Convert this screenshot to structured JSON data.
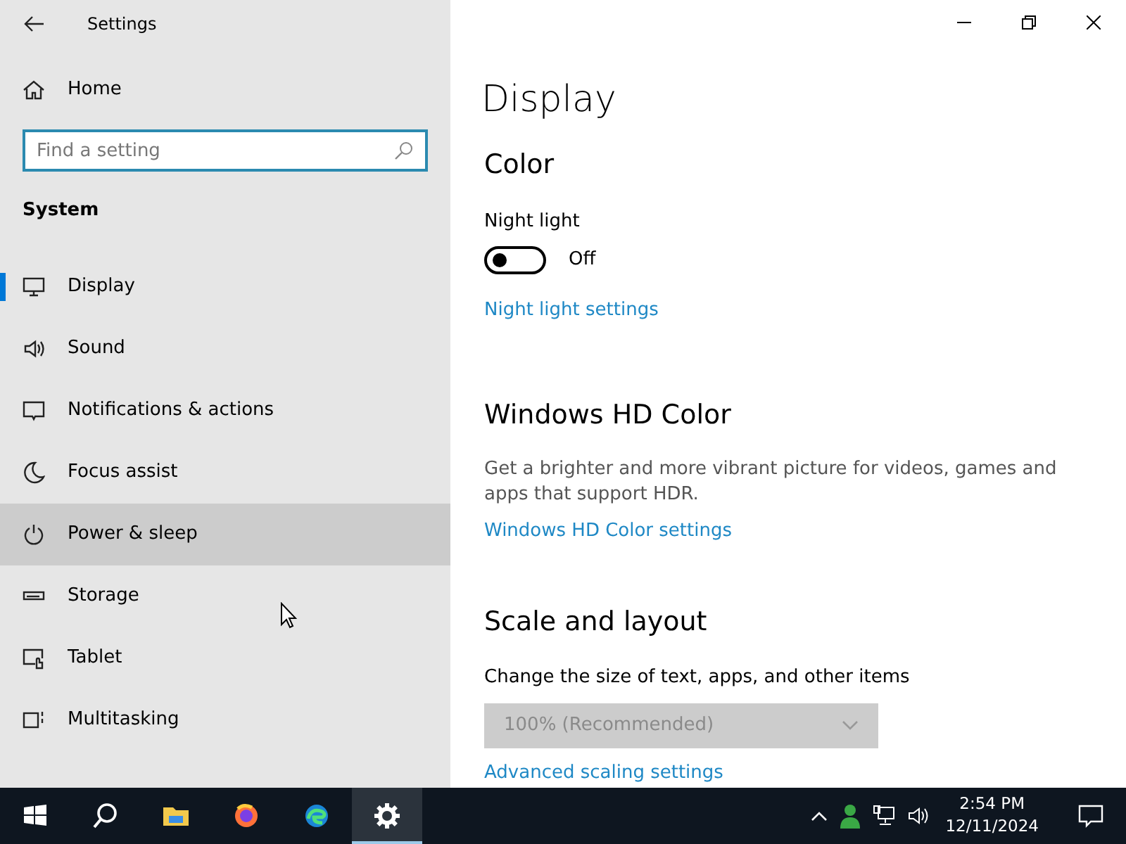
{
  "window": {
    "title": "Settings"
  },
  "sidebar": {
    "home": "Home",
    "search": {
      "placeholder": "Find a setting"
    },
    "section": "System",
    "items": [
      {
        "kind": "display",
        "label": "Display",
        "selected": true,
        "hovered": false
      },
      {
        "kind": "sound",
        "label": "Sound",
        "selected": false,
        "hovered": false
      },
      {
        "kind": "notifications",
        "label": "Notifications & actions",
        "selected": false,
        "hovered": false
      },
      {
        "kind": "focus",
        "label": "Focus assist",
        "selected": false,
        "hovered": false
      },
      {
        "kind": "power",
        "label": "Power & sleep",
        "selected": false,
        "hovered": true
      },
      {
        "kind": "storage",
        "label": "Storage",
        "selected": false,
        "hovered": false
      },
      {
        "kind": "tablet",
        "label": "Tablet",
        "selected": false,
        "hovered": false
      },
      {
        "kind": "multitasking",
        "label": "Multitasking",
        "selected": false,
        "hovered": false
      }
    ]
  },
  "content": {
    "title": "Display",
    "color": {
      "heading": "Color",
      "night_light": {
        "label": "Night light",
        "on": false,
        "state_text": "Off"
      },
      "link": "Night light settings"
    },
    "hd_color": {
      "heading": "Windows HD Color",
      "description": "Get a brighter and more vibrant picture for videos, games and apps that support HDR.",
      "link": "Windows HD Color settings"
    },
    "scale": {
      "heading": "Scale and layout",
      "label": "Change the size of text, apps, and other items",
      "dropdown": {
        "value": "100% (Recommended)",
        "disabled": true
      },
      "link": "Advanced scaling settings"
    }
  },
  "taskbar": {
    "apps": [
      {
        "kind": "start",
        "active": false
      },
      {
        "kind": "search",
        "active": false
      },
      {
        "kind": "explorer",
        "active": false
      },
      {
        "kind": "firefox",
        "active": false
      },
      {
        "kind": "edge",
        "active": false
      },
      {
        "kind": "settings",
        "active": true
      }
    ],
    "time": "2:54 PM",
    "date": "12/11/2024"
  }
}
